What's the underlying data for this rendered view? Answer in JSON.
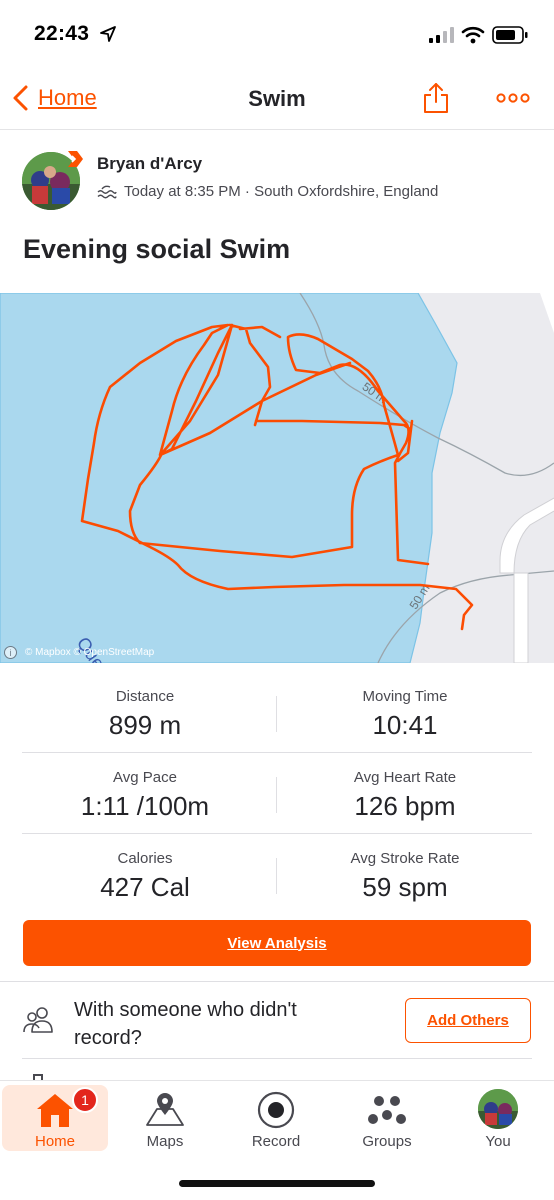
{
  "status_bar": {
    "time": "22:43"
  },
  "nav": {
    "back_label": "Home",
    "title": "Swim"
  },
  "athlete": {
    "name": "Bryan d'Arcy",
    "meta": "Today at 8:35 PM · South Oxfordshire, England"
  },
  "activity": {
    "title": "Evening social Swim"
  },
  "map": {
    "attribution": "© Mapbox © OpenStreetMap",
    "contour_label_1": "50 m",
    "contour_label_2": "50 m",
    "place_label": "Que",
    "route_color": "#fc4c02",
    "water_color": "#aad8ee"
  },
  "stats": [
    {
      "left": {
        "label": "Distance",
        "value": "899 m"
      },
      "right": {
        "label": "Moving Time",
        "value": "10:41"
      }
    },
    {
      "left": {
        "label": "Avg Pace",
        "value": "1:11 /100m"
      },
      "right": {
        "label": "Avg Heart Rate",
        "value": "126 bpm"
      }
    },
    {
      "left": {
        "label": "Calories",
        "value": "427 Cal"
      },
      "right": {
        "label": "Avg Stroke Rate",
        "value": "59 spm"
      }
    }
  ],
  "actions": {
    "view_analysis": "View Analysis",
    "others_prompt": "With someone who didn't record?",
    "add_others": "Add Others"
  },
  "tabs": {
    "home": "Home",
    "home_badge": "1",
    "maps": "Maps",
    "record": "Record",
    "groups": "Groups",
    "you": "You"
  },
  "colors": {
    "accent": "#fc5200",
    "badge": "#e3261c"
  }
}
